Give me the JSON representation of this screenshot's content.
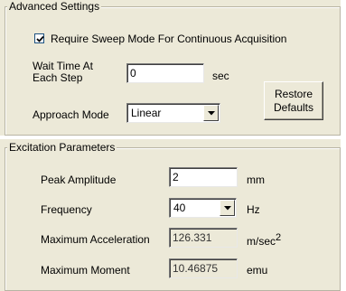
{
  "advanced": {
    "title": "Advanced Settings",
    "sweep_checkbox": {
      "label": "Require Sweep Mode For Continuous Acquisition",
      "checked": true
    },
    "wait_time": {
      "label_line1": "Wait Time At",
      "label_line2": "Each Step",
      "value": "0",
      "unit": "sec"
    },
    "approach_mode": {
      "label": "Approach Mode",
      "value": "Linear"
    },
    "restore_button": {
      "line1": "Restore",
      "line2": "Defaults"
    }
  },
  "excitation": {
    "title": "Excitation Parameters",
    "peak_amplitude": {
      "label": "Peak Amplitude",
      "value": "2",
      "unit": "mm"
    },
    "frequency": {
      "label": "Frequency",
      "value": "40",
      "unit": "Hz"
    },
    "max_acceleration": {
      "label": "Maximum  Acceleration",
      "value": "126.331",
      "unit": "m/sec",
      "unit_sup": "2"
    },
    "max_moment": {
      "label": "Maximum Moment",
      "value": "10.46875",
      "unit": "emu"
    }
  }
}
